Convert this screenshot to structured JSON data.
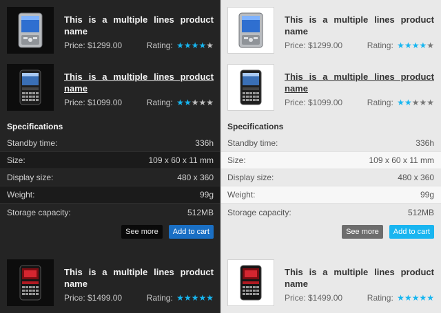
{
  "products": [
    {
      "name": "This is a multiple lines product name",
      "price": "Price: $1299.00",
      "rating_label": "Rating:",
      "rating": 4,
      "rating_max": 5,
      "phone": "pda-phone-icon"
    },
    {
      "name": "This is a multiple lines product name",
      "price": "Price: $1099.00",
      "rating_label": "Rating:",
      "rating": 2,
      "rating_max": 5,
      "phone": "qwerty-phone-icon"
    },
    {
      "name": "This is a multiple lines product name",
      "price": "Price: $1499.00",
      "rating_label": "Rating:",
      "rating": 5,
      "rating_max": 5,
      "phone": "red-qwerty-phone-icon"
    }
  ],
  "specifications": {
    "title": "Specifications",
    "rows": [
      {
        "label": "Standby time:",
        "value": "336h"
      },
      {
        "label": "Size:",
        "value": "109 x 60 x 11 mm"
      },
      {
        "label": "Display size:",
        "value": "480 x 360"
      },
      {
        "label": "Weight:",
        "value": "99g"
      },
      {
        "label": "Storage capacity:",
        "value": "512MB"
      }
    ]
  },
  "actions": {
    "see_more": "See more",
    "add_to_cart": "Add to cart"
  },
  "colors": {
    "star_on": "#17b6f0",
    "dark_cart": "#1a6fc4",
    "light_cart": "#19b5f0",
    "dark_bg": "#242424",
    "light_bg": "#e9e9e9"
  }
}
